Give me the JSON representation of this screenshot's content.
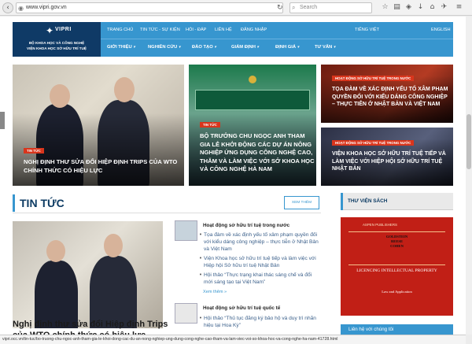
{
  "browser": {
    "url": "www.vipri.gov.vn",
    "search_placeholder": "Search",
    "status_url": "vipri.occ.vn/tin-tuc/bo-truong-chu-ngoc-anh-tham-gia-le-khoi-dong-cac-du-an-nong-nghiep-ung-dung-cong-nghe-cao-tham-va-lam-viec-voi-so-khoa-hoc-va-cong-nghe-ha-nam-41728.html"
  },
  "logo": {
    "brand": "VIPRI",
    "line1": "BỘ KHOA HỌC VÀ CÔNG NGHỆ",
    "line2": "VIỆN KHOA HỌC SỞ HỮU TRÍ TUỆ"
  },
  "topnav": {
    "home": "TRANG CHỦ",
    "news_events": "TIN TỨC - SỰ KIỆN",
    "qa": "HỎI - ĐÁP",
    "contact": "LIÊN HỆ",
    "login": "ĐĂNG NHẬP",
    "lang_vi": "TIẾNG VIỆT",
    "lang_en": "ENGLISH"
  },
  "mainnav": {
    "intro": "GIỚI THIỆU",
    "research": "NGHIÊN CỨU",
    "training": "ĐÀO TẠO",
    "appraisal": "GIÁM ĐỊNH",
    "evaluation": "ĐỊNH GIÁ",
    "consulting": "TƯ VẤN"
  },
  "hero": {
    "left_badge": "TIN TỨC",
    "left_title": "NGHỊ ĐỊNH THƯ SỬA ĐỔI HIỆP ĐỊNH TRIPS CỦA WTO CHÍNH THỨC CÓ HIỆU LỰC",
    "mid_badge": "TIN TỨC",
    "mid_title": "BỘ TRƯỞNG CHU NGỌC ANH THAM GIA LỄ KHỞI ĐỘNG CÁC DỰ ÁN NÔNG NGHIỆP ỨNG DỤNG CÔNG NGHỆ CAO, THĂM VÀ LÀM VIỆC VỚI SỞ KHOA HỌC VÀ CÔNG NGHỆ HÀ NAM",
    "rt_badge": "HOẠT ĐỘNG SỞ HỮU TRÍ TUỆ TRONG NƯỚC",
    "rt_title": "TỌA ĐÀM VỀ XÁC ĐỊNH YẾU TỐ XÂM PHẠM QUYỀN ĐỐI VỚI KIỂU DÁNG CÔNG NGHIỆP – THỰC TIỄN Ở NHẬT BẢN VÀ VIỆT NAM",
    "rb_badge": "HOẠT ĐỘNG SỞ HỮU TRÍ TUỆ TRONG NƯỚC",
    "rb_title": "VIỆN KHOA HỌC SỞ HỮU TRÍ TUỆ TIẾP VÀ LÀM VIỆC VỚI HIỆP HỘI SỞ HỮU TRÍ TUỆ NHẬT BẢN"
  },
  "news": {
    "heading": "TIN TỨC",
    "more_button": "XEM THÊM",
    "lead_title": "Nghị định thư sửa đổi Hiệp định Trips của WTO chính thức có hiệu lực",
    "domestic_title": "Hoạt động sở hữu trí tuệ trong nước",
    "domestic_items": [
      "Tọa đàm về xác định yếu tố xâm phạm quyền đối với kiểu dáng công nghiệp – thực tiễn ở Nhật Bản và Việt Nam",
      "Viện Khoa học sở hữu trí tuệ tiếp và làm việc với Hiệp hội Sở hữu trí tuệ Nhật Bản",
      "Hội thảo “Thực trạng khai thác sáng chế và đổi mới sáng tạo tại Việt Nam”"
    ],
    "domestic_more": "Xem thêm »",
    "intl_title": "Hoạt động sở hữu trí tuệ quốc tế",
    "intl_items": [
      "Hội thảo “Thủ tục đăng ký bảo hộ và duy trì nhãn hiệu tại Hoa Kỳ”"
    ]
  },
  "library": {
    "heading": "THƯ VIỆN SÁCH",
    "book_publisher": "ASPEN PUBLISHERS",
    "book_authors": "GOLDSTEIN\nREESE\nCOHEN",
    "book_title": "LICENCING INTELLECTUAL PROPERTY",
    "book_subtitle": "Law and Application"
  },
  "chat": {
    "label": "Liên hệ với chúng tôi"
  },
  "colors": {
    "accent": "#3796cf",
    "logo_bg": "#0f3a66",
    "badge": "#d9351c"
  }
}
